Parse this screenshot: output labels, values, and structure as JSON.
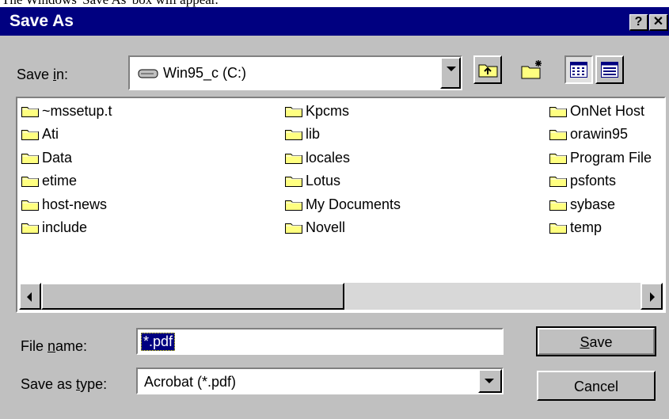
{
  "caption": "The Windows 'Save As' box will appear.",
  "window": {
    "title": "Save As",
    "help_button": "?",
    "close_button": "✕"
  },
  "save_in": {
    "label": "Save in:",
    "value": "Win95_c (C:)"
  },
  "toolbar": {
    "up_folder_icon": "up-one-level-icon",
    "new_folder_icon": "create-new-folder-icon",
    "list_icon": "list-view-icon",
    "details_icon": "details-view-icon"
  },
  "files": {
    "col1": [
      "~mssetup.t",
      "Ati",
      "Data",
      "etime",
      "host-news",
      "include"
    ],
    "col2": [
      "Kpcms",
      "lib",
      "locales",
      "Lotus",
      "My Documents",
      "Novell"
    ],
    "col3": [
      "OnNet Host",
      "orawin95",
      "Program File",
      "psfonts",
      "sybase",
      "temp"
    ]
  },
  "file_name": {
    "label": "File name:",
    "value": "*.pdf"
  },
  "save_as_type": {
    "label": "Save as type:",
    "value": "Acrobat (*.pdf)"
  },
  "buttons": {
    "save": "Save",
    "cancel": "Cancel"
  },
  "colors": {
    "titlebar": "#000080",
    "dialog": "#c0c0c0",
    "folder": "#ffff80",
    "selection": "#000080"
  }
}
